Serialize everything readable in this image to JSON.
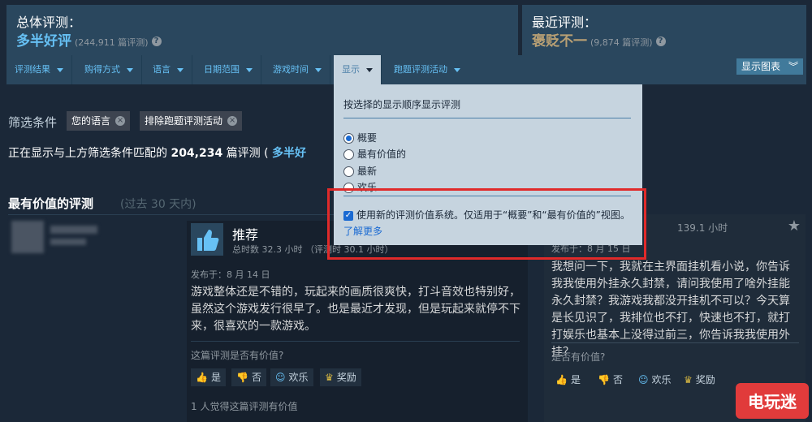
{
  "summary": {
    "overall": {
      "title": "总体评测：",
      "rating": "多半好评",
      "count": "(244,911 篇评测)",
      "rating_color": "#66c0f4"
    },
    "recent": {
      "title": "最近评测：",
      "rating": "褒贬不一",
      "count": "(9,874 篇评测)",
      "rating_color": "#b9a074"
    }
  },
  "filter_bar": {
    "items": [
      {
        "label": "评测结果"
      },
      {
        "label": "购得方式"
      },
      {
        "label": "语言"
      },
      {
        "label": "日期范围"
      },
      {
        "label": "游戏时间"
      },
      {
        "label": "显示"
      },
      {
        "label": "跑题评测活动"
      }
    ],
    "graph_button": "显示图表"
  },
  "filters": {
    "label": "筛选条件",
    "chips": [
      "您的语言",
      "排除跑题评测活动"
    ],
    "showing_prefix": "正在显示与上方筛选条件匹配的",
    "showing_count": "204,234",
    "showing_suffix": "篇评测 (",
    "showing_rating": "多半好"
  },
  "section": {
    "title": "最有价值的评测",
    "subtitle": "(过去 30 天内)"
  },
  "dropdown": {
    "header": "按选择的显示顺序显示评测",
    "options": [
      "概要",
      "最有价值的",
      "最新",
      "欢乐"
    ],
    "selected_index": 0,
    "checkbox_label": "使用新的评测价值系统。仅适用于“概要”和“最有价值的”视图。",
    "checkbox_checked": true,
    "learn_more": "了解更多"
  },
  "review": {
    "recommend": "推荐",
    "hours": "总时数 32.3 小时 （评测时 30.1 小时）",
    "date": "发布于：8 月 14 日",
    "text": "游戏整体还是不错的，玩起来的画质很爽快，打斗音效也特别好，虽然这个游戏发行很早了。也是最近才发现，但是玩起来就停不下来，很喜欢的一款游戏。",
    "helpful_question": "这篇评测是否有价值?",
    "buttons": {
      "yes": "是",
      "no": "否",
      "funny": "欢乐",
      "award": "奖励"
    },
    "found_helpful": "1 人觉得这篇评测有价值"
  },
  "right_review": {
    "hours": "139.1 小时",
    "date": "发布于：8 月 15 日",
    "text": "我想问一下，我就在主界面挂机看小说，你告诉我我使用外挂永久封禁，请问我使用了啥外挂能永久封禁？我游戏我都没开挂机不可以？今天算是长见识了，我排位也不打，快速也不打，就打打娱乐也基本上没得过前三，你告诉我我使用外挂？",
    "helpful_question": "是否有价值?",
    "buttons": {
      "yes": "是",
      "no": "否",
      "funny": "欢乐",
      "award": "奖励"
    }
  },
  "watermark": "电玩迷"
}
